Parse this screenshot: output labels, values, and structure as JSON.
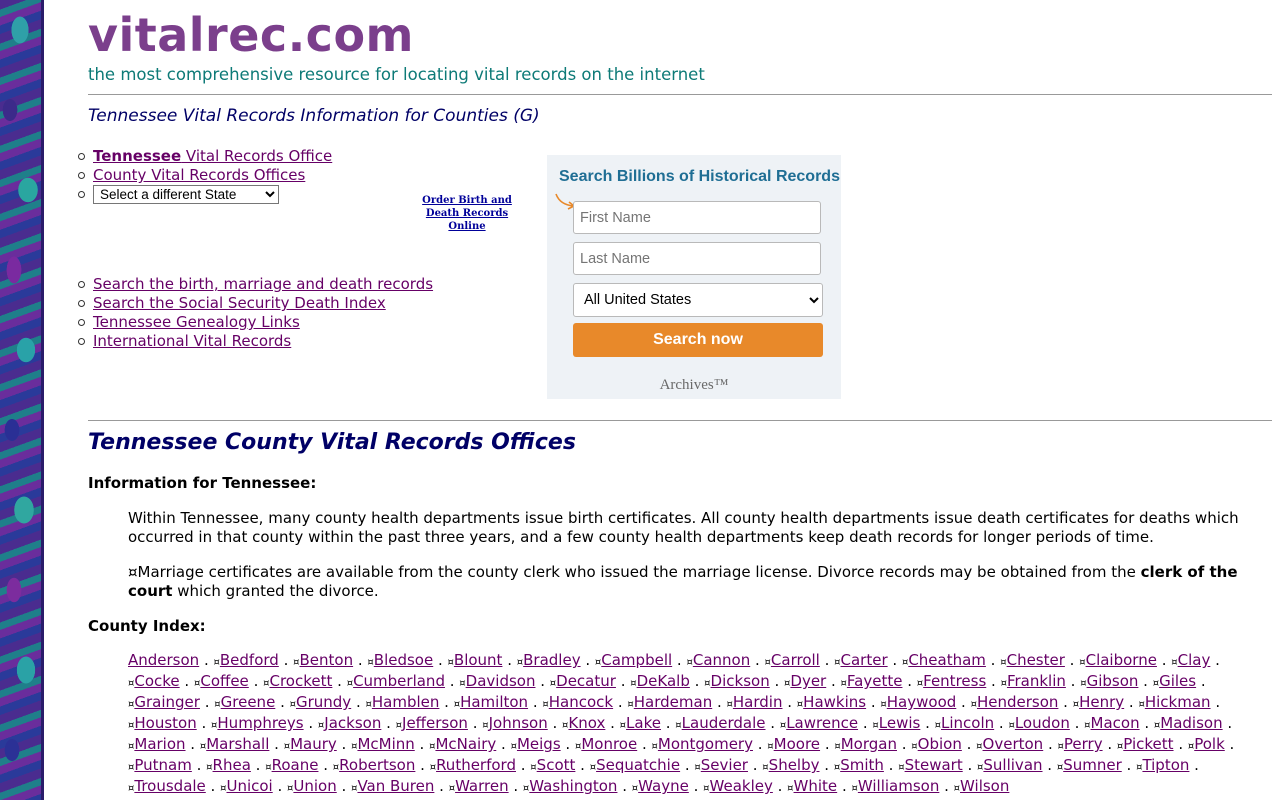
{
  "site": {
    "name": "vitalrec.com",
    "tagline": "the most comprehensive resource for locating vital records on the internet"
  },
  "page_subtitle": "Tennessee Vital Records Information for Counties (G)",
  "top_links": {
    "state_office_bold": "Tennessee",
    "state_office_rest": " Vital Records Office",
    "county_offices": "County Vital Records Offices",
    "state_select_value": "Select a different State"
  },
  "order_link": {
    "line1": "Order Birth and",
    "line2": "Death Records Online"
  },
  "search_links": [
    "Search the birth, marriage and death records",
    "Search the Social Security Death Index",
    "Tennessee Genealogy Links",
    "International Vital Records"
  ],
  "widget": {
    "title": "Search Billions of Historical Records",
    "first_name_placeholder": "First Name",
    "last_name_placeholder": "Last Name",
    "location_value": "All United States",
    "button": "Search now",
    "brand": "Archives™"
  },
  "section_title": "Tennessee County Vital Records Offices",
  "info_label": "Information for Tennessee:",
  "paragraph1": "Within Tennessee, many county health departments issue birth certificates. All county health departments issue death certificates for deaths which occurred in that county within the past three years, and a few county health departments keep death records for longer periods of time.",
  "paragraph2_start": "¤Marriage certificates are available from the county clerk who issued the marriage license. Divorce records may be obtained from the ",
  "paragraph2_bold": "clerk of the court",
  "paragraph2_end": " which granted the divorce.",
  "county_index_label": "County Index:",
  "county_marker": "¤",
  "county_separator": " . ",
  "counties": [
    "Anderson",
    "Bedford",
    "Benton",
    "Bledsoe",
    "Blount",
    "Bradley",
    "Campbell",
    "Cannon",
    "Carroll",
    "Carter",
    "Cheatham",
    "Chester",
    "Claiborne",
    "Clay",
    "Cocke",
    "Coffee",
    "Crockett",
    "Cumberland",
    "Davidson",
    "Decatur",
    "DeKalb",
    "Dickson",
    "Dyer",
    "Fayette",
    "Fentress",
    "Franklin",
    "Gibson",
    "Giles",
    "Grainger",
    "Greene",
    "Grundy",
    "Hamblen",
    "Hamilton",
    "Hancock",
    "Hardeman",
    "Hardin",
    "Hawkins",
    "Haywood",
    "Henderson",
    "Henry",
    "Hickman",
    "Houston",
    "Humphreys",
    "Jackson",
    "Jefferson",
    "Johnson",
    "Knox",
    "Lake",
    "Lauderdale",
    "Lawrence",
    "Lewis",
    "Lincoln",
    "Loudon",
    "Macon",
    "Madison",
    "Marion",
    "Marshall",
    "Maury",
    "McMinn",
    "McNairy",
    "Meigs",
    "Monroe",
    "Montgomery",
    "Moore",
    "Morgan",
    "Obion",
    "Overton",
    "Perry",
    "Pickett",
    "Polk",
    "Putnam",
    "Rhea",
    "Roane",
    "Robertson",
    "Rutherford",
    "Scott",
    "Sequatchie",
    "Sevier",
    "Shelby",
    "Smith",
    "Stewart",
    "Sullivan",
    "Sumner",
    "Tipton",
    "Trousdale",
    "Unicoi",
    "Union",
    "Van Buren",
    "Warren",
    "Washington",
    "Wayne",
    "Weakley",
    "White",
    "Williamson",
    "Wilson"
  ]
}
